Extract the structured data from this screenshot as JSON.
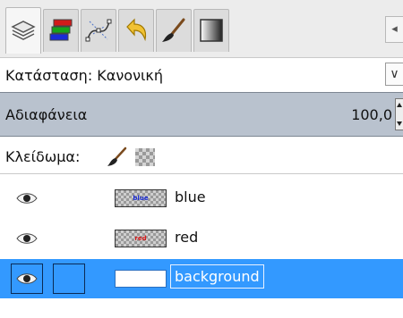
{
  "tabs": [
    {
      "name": "layers-tab",
      "icon": "layers-icon",
      "active": true
    },
    {
      "name": "channels-tab",
      "icon": "channels-icon",
      "active": false
    },
    {
      "name": "paths-tab",
      "icon": "paths-icon",
      "active": false
    },
    {
      "name": "undo-history-tab",
      "icon": "undo-icon",
      "active": false
    },
    {
      "name": "brushes-tab",
      "icon": "brush-icon",
      "active": false
    },
    {
      "name": "gradients-tab",
      "icon": "gradient-icon",
      "active": false
    }
  ],
  "mode": {
    "label": "Κατάσταση: Κανονική"
  },
  "opacity": {
    "label": "Αδιαφάνεια",
    "value": "100,0"
  },
  "lock": {
    "label": "Κλείδωμα:"
  },
  "layers": [
    {
      "name": "blue",
      "thumb_text": "blue",
      "thumb_color": "#1a2bd6",
      "selected": false
    },
    {
      "name": "red",
      "thumb_text": "red",
      "thumb_color": "#d61a1a",
      "selected": false
    },
    {
      "name": "background",
      "selected": true
    }
  ],
  "colors": {
    "accent": "#3399ff",
    "opacity_bar": "#b9c2ce"
  }
}
